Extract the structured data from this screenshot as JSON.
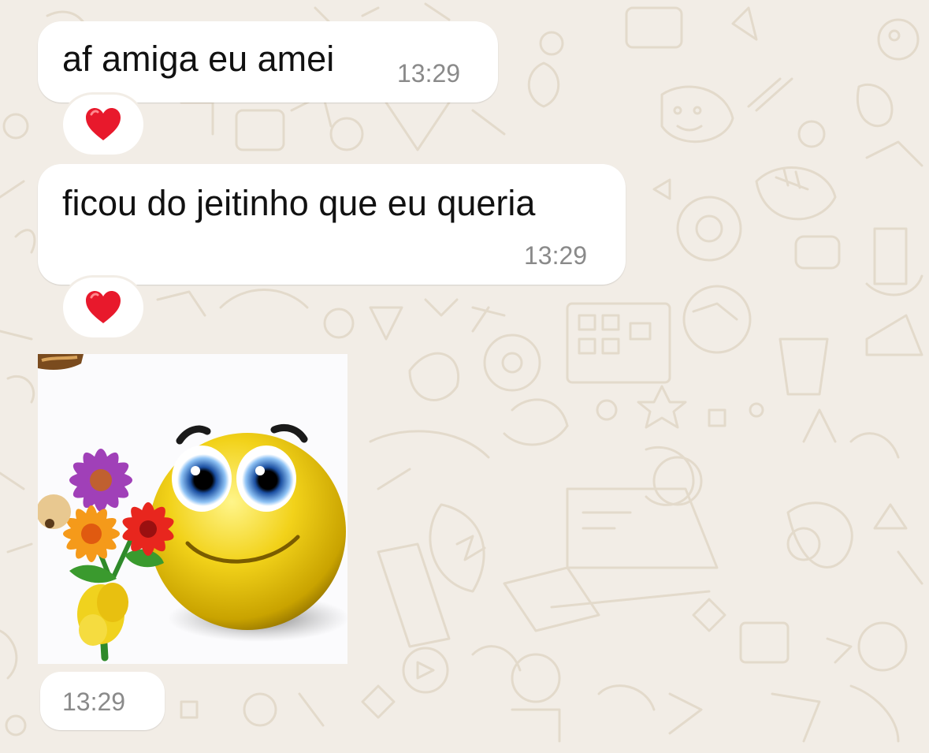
{
  "chat": {
    "background_color": "#f2ede6",
    "doodle_color": "#e3dacb",
    "messages": [
      {
        "text": "af amiga eu amei",
        "time": "13:29",
        "reaction": {
          "emoji": "❤️",
          "icon": "red-heart-icon"
        }
      },
      {
        "text": "ficou do jeitinho que eu queria",
        "time": "13:29",
        "reaction": {
          "emoji": "❤️",
          "icon": "red-heart-icon"
        }
      },
      {
        "type": "sticker",
        "sticker": "smiley-face-holding-flower-bouquet",
        "time": "13:29"
      }
    ]
  },
  "colors": {
    "bubble": "#ffffff",
    "text": "#111111",
    "timestamp": "#8a8a8a",
    "heart": "#e8192c"
  }
}
